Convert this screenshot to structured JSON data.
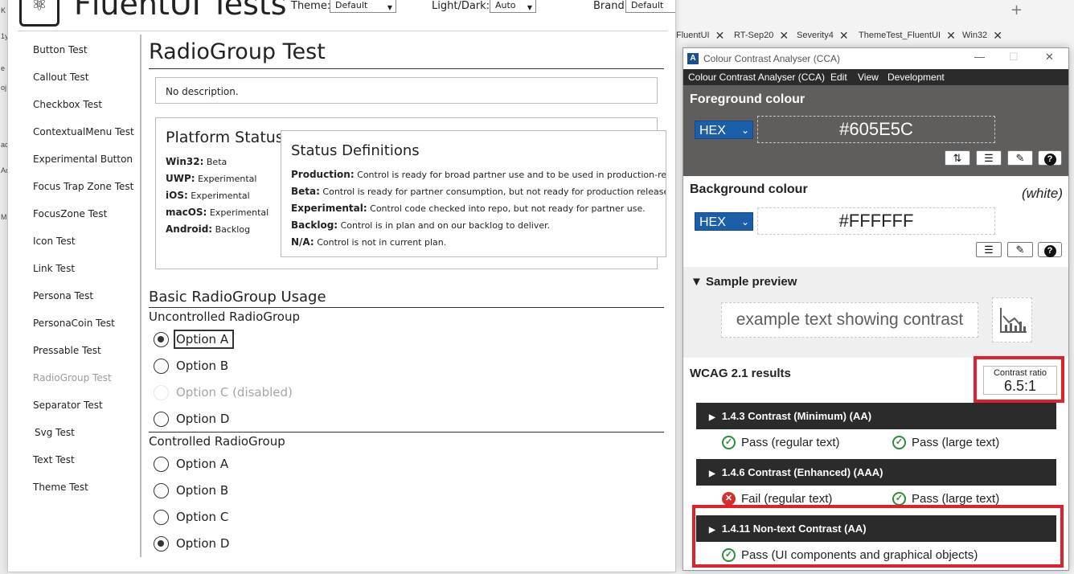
{
  "browser": {
    "tabs": [
      "FluentUI",
      "RT-Sep20",
      "Severity4",
      "ThemeTest_FluentUI",
      "Win32"
    ],
    "tab_close": "✕",
    "new_tab": "+",
    "left_letters": [
      "K",
      "1y",
      "e",
      "oj",
      "ac",
      "Ac",
      "M"
    ]
  },
  "app": {
    "title": "FluentUI Tests",
    "theme_label": "Theme:",
    "theme_value": "Default",
    "lightdark_label": "Light/Dark:",
    "lightdark_value": "Auto",
    "brand_label": "Brand:",
    "brand_value": "Default",
    "nav": [
      {
        "label": "Button Test"
      },
      {
        "label": "Callout Test"
      },
      {
        "label": "Checkbox Test"
      },
      {
        "label": "ContextualMenu Test"
      },
      {
        "label": "Experimental Button"
      },
      {
        "label": "Focus Trap Zone Test"
      },
      {
        "label": "FocusZone Test"
      },
      {
        "label": "Icon Test"
      },
      {
        "label": "Link Test"
      },
      {
        "label": "Persona Test"
      },
      {
        "label": "PersonaCoin Test"
      },
      {
        "label": "Pressable Test"
      },
      {
        "label": "RadioGroup Test"
      },
      {
        "label": "Separator Test"
      },
      {
        "label": "Svg Test"
      },
      {
        "label": "Text Test"
      },
      {
        "label": "Theme Test"
      }
    ],
    "page_title": "RadioGroup Test",
    "description": "No description.",
    "platform_status": {
      "title": "Platform Status",
      "rows": [
        {
          "platform": "Win32:",
          "status": "Beta"
        },
        {
          "platform": "UWP:",
          "status": "Experimental"
        },
        {
          "platform": "iOS:",
          "status": "Experimental"
        },
        {
          "platform": "macOS:",
          "status": "Experimental"
        },
        {
          "platform": "Android:",
          "status": "Backlog"
        }
      ]
    },
    "status_definitions": {
      "title": "Status Definitions",
      "rows": [
        {
          "term": "Production:",
          "text": "Control is ready for broad partner use and to be used in production-read"
        },
        {
          "term": "Beta:",
          "text": "Control is ready for partner consumption, but not ready for production release (e"
        },
        {
          "term": "Experimental:",
          "text": "Control code checked into repo, but not ready for partner use."
        },
        {
          "term": "Backlog:",
          "text": "Control is in plan and on our backlog to deliver."
        },
        {
          "term": "N/A:",
          "text": "Control is not in current plan."
        }
      ]
    },
    "basic_title": "Basic RadioGroup Usage",
    "uncontrolled_title": "Uncontrolled RadioGroup",
    "uncontrolled_options": [
      {
        "label": "Option A",
        "checked": true,
        "disabled": false
      },
      {
        "label": "Option B",
        "checked": false,
        "disabled": false
      },
      {
        "label": "Option C (disabled)",
        "checked": false,
        "disabled": true
      },
      {
        "label": "Option D",
        "checked": false,
        "disabled": false
      }
    ],
    "controlled_title": "Controlled RadioGroup",
    "controlled_options": [
      {
        "label": "Option A",
        "checked": false
      },
      {
        "label": "Option B",
        "checked": false
      },
      {
        "label": "Option C",
        "checked": false
      },
      {
        "label": "Option D",
        "checked": true
      }
    ]
  },
  "cca": {
    "window_title": "Colour Contrast Analyser (CCA)",
    "menu": [
      "Colour Contrast Analyser (CCA)",
      "Edit",
      "View",
      "Development"
    ],
    "foreground_label": "Foreground colour",
    "foreground_format": "HEX",
    "foreground_value": "#605E5C",
    "background_label": "Background colour",
    "background_name": "(white)",
    "background_format": "HEX",
    "background_value": "#FFFFFF",
    "sample_header": "Sample preview",
    "sample_text": "example text showing contrast",
    "wcag_title": "WCAG 2.1 results",
    "ratio_label": "Contrast ratio",
    "ratio_value": "6.5:1",
    "criteria": [
      {
        "title": "1.4.3 Contrast (Minimum) (AA)",
        "results": [
          {
            "pass": true,
            "text": "Pass (regular text)"
          },
          {
            "pass": true,
            "text": "Pass (large text)"
          }
        ]
      },
      {
        "title": "1.4.6 Contrast (Enhanced) (AAA)",
        "results": [
          {
            "pass": false,
            "text": "Fail (regular text)"
          },
          {
            "pass": true,
            "text": "Pass (large text)"
          }
        ]
      },
      {
        "title": "1.4.11 Non-text Contrast (AA)",
        "results": [
          {
            "pass": true,
            "text": "Pass (UI components and graphical objects)"
          }
        ]
      }
    ],
    "colors": {
      "foreground": "#605e5c",
      "background": "#ffffff",
      "pass": "#2e8b3a",
      "fail": "#d62d2d",
      "highlight": "#e0202a",
      "format_select": "#1b5fab"
    }
  }
}
